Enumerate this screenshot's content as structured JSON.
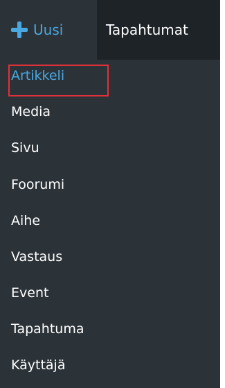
{
  "toolbar": {
    "new_label": "Uusi",
    "new_icon": "plus-icon",
    "events_label": "Tapahtumat"
  },
  "new_menu": {
    "items": [
      {
        "label": "Artikkeli",
        "active": true
      },
      {
        "label": "Media"
      },
      {
        "label": "Sivu"
      },
      {
        "label": "Foorumi"
      },
      {
        "label": "Aihe"
      },
      {
        "label": "Vastaus"
      },
      {
        "label": "Event"
      },
      {
        "label": "Tapahtuma"
      },
      {
        "label": "Käyttäjä"
      }
    ]
  },
  "colors": {
    "background": "#2c3338",
    "dark_item": "#1d2327",
    "accent": "#4aa8e0",
    "text": "#ffffff",
    "highlight": "#e2303a"
  }
}
